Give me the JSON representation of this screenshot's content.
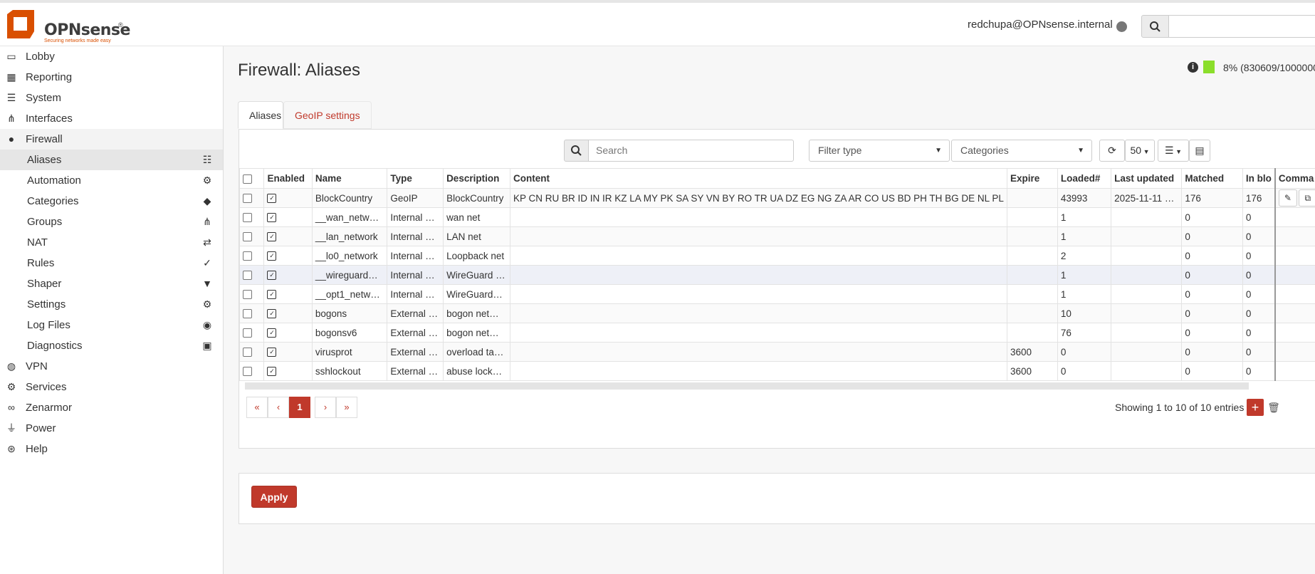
{
  "header": {
    "brand": "OPNsense",
    "tagline": "Securing networks made easy",
    "user": "redchupa@OPNsense.internal"
  },
  "sidebar": {
    "items": [
      {
        "label": "Lobby",
        "icon": "laptop-icon"
      },
      {
        "label": "Reporting",
        "icon": "chart-icon"
      },
      {
        "label": "System",
        "icon": "server-icon"
      },
      {
        "label": "Interfaces",
        "icon": "sitemap-icon"
      },
      {
        "label": "Firewall",
        "icon": "fire-icon"
      }
    ],
    "firewall_sub": [
      {
        "label": "Aliases",
        "icon": "list-icon"
      },
      {
        "label": "Automation",
        "icon": "gear-icon"
      },
      {
        "label": "Categories",
        "icon": "tags-icon"
      },
      {
        "label": "Groups",
        "icon": "sitemap-icon"
      },
      {
        "label": "NAT",
        "icon": "exchange-icon"
      },
      {
        "label": "Rules",
        "icon": "check-icon"
      },
      {
        "label": "Shaper",
        "icon": "filter-icon"
      },
      {
        "label": "Settings",
        "icon": "gears-icon"
      },
      {
        "label": "Log Files",
        "icon": "eye-icon"
      },
      {
        "label": "Diagnostics",
        "icon": "medkit-icon"
      }
    ],
    "bottom_items": [
      {
        "label": "VPN",
        "icon": "globe-icon"
      },
      {
        "label": "Services",
        "icon": "cog-icon"
      },
      {
        "label": "Zenarmor",
        "icon": "binoculars-icon"
      },
      {
        "label": "Power",
        "icon": "plug-icon"
      },
      {
        "label": "Help",
        "icon": "lifebuoy-icon"
      }
    ]
  },
  "main": {
    "title": "Firewall: Aliases",
    "usage": "8% (830609/1000000",
    "tabs": [
      "Aliases",
      "GeoIP settings"
    ],
    "search_placeholder": "Search",
    "filter_type": "Filter type",
    "categories": "Categories",
    "page_size": "50",
    "columns": [
      "Enabled",
      "Name",
      "Type",
      "Description",
      "Content",
      "Expire",
      "Loaded#",
      "Last updated",
      "Matched",
      "In blo",
      "Comma"
    ],
    "rows": [
      {
        "name": "BlockCountry",
        "type": "GeoIP",
        "description": "BlockCountry",
        "content": "KP CN RU BR ID IN IR KZ LA MY PK SA SY VN BY RO TR UA DZ EG NG ZA AR CO US BD PH TH BG DE NL PL",
        "expire": "",
        "loaded": "43993",
        "updated": "2025-11-11 …",
        "matched": "176",
        "inblock": "176"
      },
      {
        "name": "__wan_netw…",
        "type": "Internal …",
        "description": "wan net",
        "content": "",
        "expire": "",
        "loaded": "1",
        "updated": "",
        "matched": "0",
        "inblock": "0"
      },
      {
        "name": "__lan_network",
        "type": "Internal …",
        "description": "LAN net",
        "content": "",
        "expire": "",
        "loaded": "1",
        "updated": "",
        "matched": "0",
        "inblock": "0"
      },
      {
        "name": "__lo0_network",
        "type": "Internal …",
        "description": "Loopback net",
        "content": "",
        "expire": "",
        "loaded": "2",
        "updated": "",
        "matched": "0",
        "inblock": "0"
      },
      {
        "name": "__wireguard…",
        "type": "Internal …",
        "description": "WireGuard …",
        "content": "",
        "expire": "",
        "loaded": "1",
        "updated": "",
        "matched": "0",
        "inblock": "0"
      },
      {
        "name": "__opt1_netw…",
        "type": "Internal …",
        "description": "WireGuard…",
        "content": "",
        "expire": "",
        "loaded": "1",
        "updated": "",
        "matched": "0",
        "inblock": "0"
      },
      {
        "name": "bogons",
        "type": "External …",
        "description": "bogon net…",
        "content": "",
        "expire": "",
        "loaded": "10",
        "updated": "",
        "matched": "0",
        "inblock": "0"
      },
      {
        "name": "bogonsv6",
        "type": "External …",
        "description": "bogon net…",
        "content": "",
        "expire": "",
        "loaded": "76",
        "updated": "",
        "matched": "0",
        "inblock": "0"
      },
      {
        "name": "virusprot",
        "type": "External …",
        "description": "overload ta…",
        "content": "",
        "expire": "3600",
        "loaded": "0",
        "updated": "",
        "matched": "0",
        "inblock": "0"
      },
      {
        "name": "sshlockout",
        "type": "External …",
        "description": "abuse lock…",
        "content": "",
        "expire": "3600",
        "loaded": "0",
        "updated": "",
        "matched": "0",
        "inblock": "0"
      }
    ],
    "pager": {
      "first": "«",
      "prev": "‹",
      "current": "1",
      "next": "›",
      "last": "»"
    },
    "showing": "Showing 1 to 10 of 10 entries",
    "apply_label": "Apply"
  },
  "colors": {
    "accent": "#c0392b",
    "brand_orange": "#d94f00",
    "usage_green": "#8bde2b"
  }
}
